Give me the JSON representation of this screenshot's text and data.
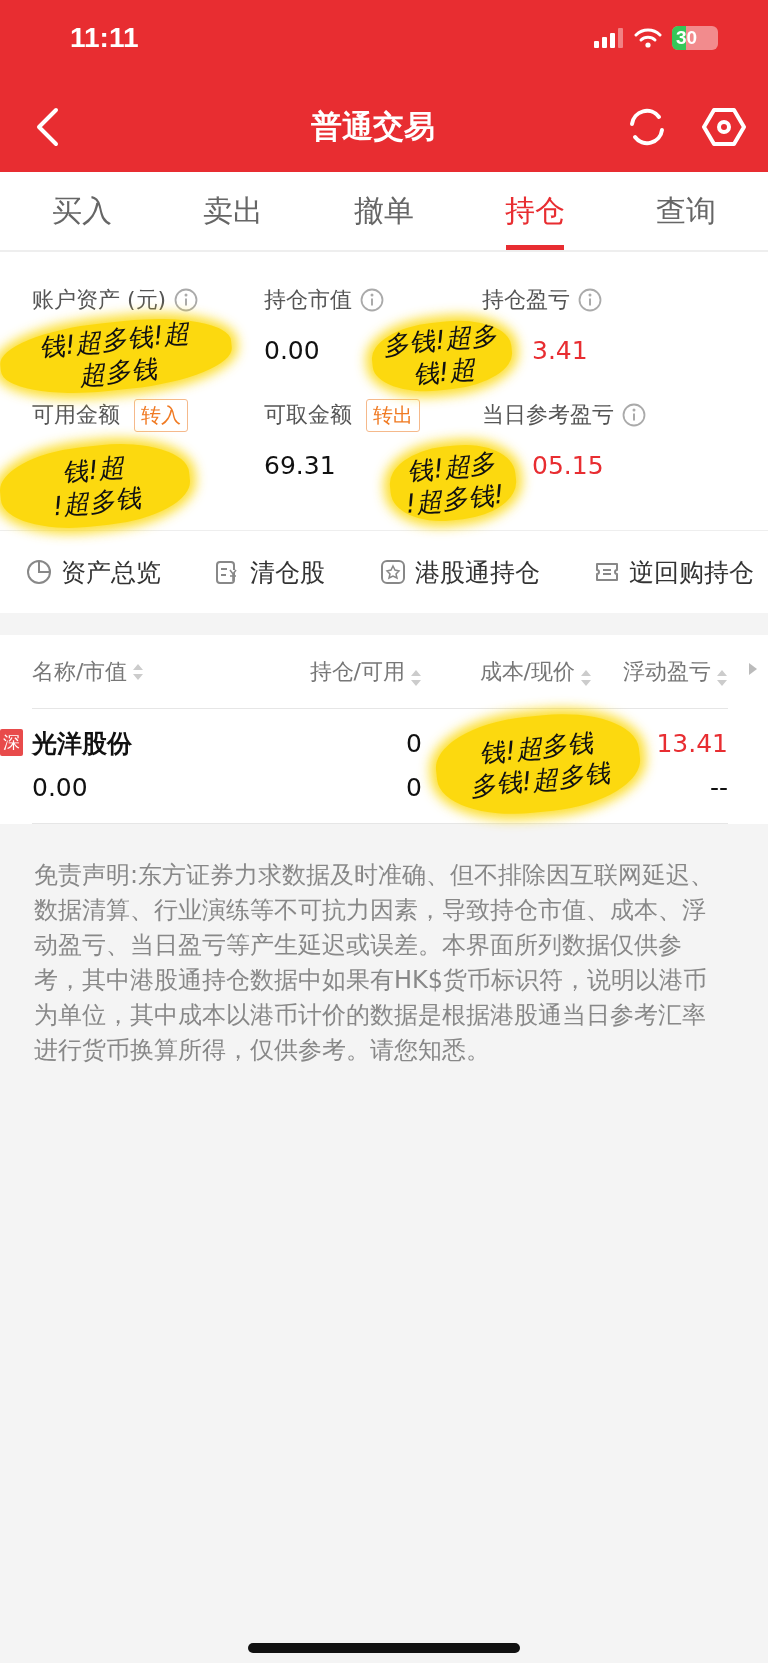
{
  "status_bar": {
    "time": "11:11",
    "battery": "30"
  },
  "header": {
    "title": "普通交易"
  },
  "tabs": [
    {
      "label": "买入",
      "selected": false
    },
    {
      "label": "卖出",
      "selected": false
    },
    {
      "label": "撤单",
      "selected": false
    },
    {
      "label": "持仓",
      "selected": true
    },
    {
      "label": "查询",
      "selected": false
    }
  ],
  "account": [
    {
      "label": "账户资产 (元)",
      "kind": "info"
    },
    {
      "label": "持仓市值",
      "kind": "info",
      "value": "0.00",
      "negative": false
    },
    {
      "label": "持仓盈亏",
      "kind": "info",
      "value": "3.41",
      "negative": true
    },
    {
      "label": "可用金额",
      "kind": "action",
      "action": "转入"
    },
    {
      "label": "可取金额",
      "kind": "action",
      "action": "转出",
      "value": "69.31",
      "negative": false
    },
    {
      "label": "当日参考盈亏",
      "kind": "info",
      "value": "05.15",
      "negative": true
    }
  ],
  "quick_links": [
    {
      "label": "资产总览"
    },
    {
      "label": "清仓股"
    },
    {
      "label": "港股通持仓"
    },
    {
      "label": "逆回购持仓"
    }
  ],
  "table": {
    "columns": [
      "名称/市值",
      "持仓/可用",
      "成本/现价",
      "浮动盈亏"
    ],
    "rows": [
      {
        "market": "深",
        "name": "光洋股份",
        "market_value": "0.00",
        "holding": "0",
        "available": "0",
        "pnl": "13.41",
        "pnl_rate": "--",
        "negative": true
      }
    ]
  },
  "disclaimer": "免责声明:东方证券力求数据及时准确、但不排除因互联网延迟、数据清算、行业演练等不可抗力因素，导致持仓市值、成本、浮动盈亏、当日盈亏等产生延迟或误差。本界面所列数据仅供参考，其中港股通持仓数据中如果有HK$货币标识符，说明以港币为单位，其中成本以港币计价的数据是根据港股通当日参考汇率进行货币换算所得，仅供参考。请您知悉。",
  "stickers": [
    {
      "lines": [
        "钱!超多钱!超",
        "超多钱"
      ]
    },
    {
      "lines": [
        "多钱!超多",
        "钱!超"
      ]
    },
    {
      "lines": [
        "钱!超",
        "!超多钱"
      ]
    },
    {
      "lines": [
        "钱!超多",
        "!超多钱!"
      ]
    },
    {
      "lines": [
        "钱!超多钱",
        "多钱!超多钱"
      ]
    }
  ]
}
